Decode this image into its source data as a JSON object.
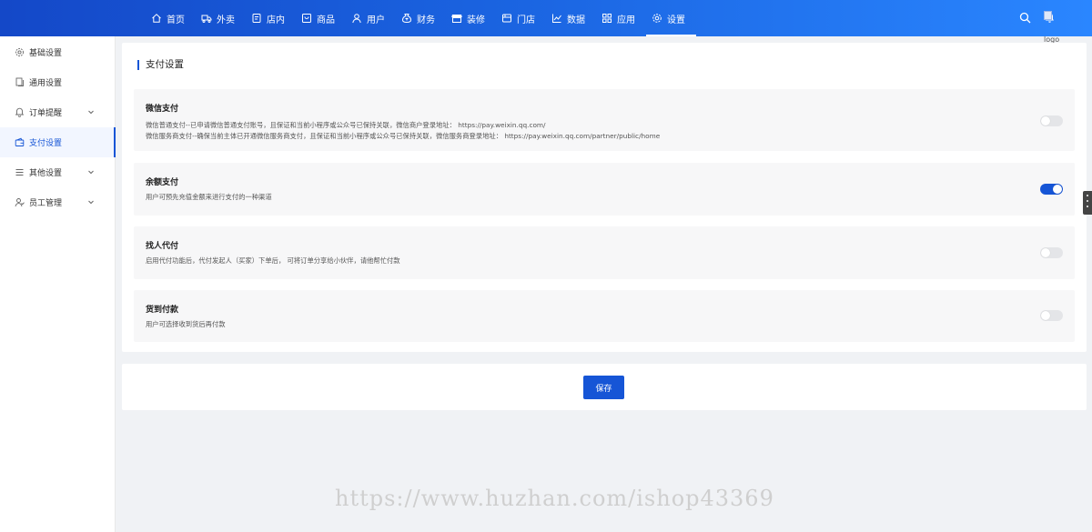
{
  "nav": {
    "items": [
      {
        "label": "首页",
        "icon": "home-icon"
      },
      {
        "label": "外卖",
        "icon": "delivery-icon"
      },
      {
        "label": "店内",
        "icon": "dine-in-icon"
      },
      {
        "label": "商品",
        "icon": "product-icon"
      },
      {
        "label": "用户",
        "icon": "user-icon"
      },
      {
        "label": "财务",
        "icon": "finance-icon"
      },
      {
        "label": "装修",
        "icon": "store-decor-icon"
      },
      {
        "label": "门店",
        "icon": "store-icon"
      },
      {
        "label": "数据",
        "icon": "chart-icon"
      },
      {
        "label": "应用",
        "icon": "apps-icon"
      },
      {
        "label": "设置",
        "icon": "gear-icon"
      }
    ],
    "active": "设置",
    "logo_alt": "logo"
  },
  "sidebar": {
    "items": [
      {
        "label": "基础设置",
        "icon": "settings-icon"
      },
      {
        "label": "通用设置",
        "icon": "document-icon"
      },
      {
        "label": "订单提醒",
        "icon": "bell-icon"
      },
      {
        "label": "支付设置",
        "icon": "wallet-icon"
      },
      {
        "label": "其他设置",
        "icon": "list-icon"
      },
      {
        "label": "员工管理",
        "icon": "staff-icon"
      }
    ],
    "active": "支付设置"
  },
  "payment": {
    "title": "支付设置",
    "options": [
      {
        "title": "微信支付",
        "desc1": "微信普通支付--已申请微信普通支付账号，且保证和当前小程序或公众号已保持关联，微信商户登录地址： https://pay.weixin.qq.com/",
        "desc2": "微信服务商支付--确保当前主体已开通微信服务商支付，且保证和当前小程序或公众号已保持关联，微信服务商登录地址： https://pay.weixin.qq.com/partner/public/home",
        "enabled": false
      },
      {
        "title": "余额支付",
        "desc1": "用户可预先充值金额来进行支付的一种渠道",
        "enabled": true
      },
      {
        "title": "找人代付",
        "desc1": "启用代付功能后，代付发起人（买家）下单后， 可将订单分享给小伙伴，请他帮忙付款",
        "enabled": false
      },
      {
        "title": "货到付款",
        "desc1": "用户可选择收到货后再付款",
        "enabled": false
      }
    ]
  },
  "save_label": "保存",
  "watermark": "https://www.huzhan.com/ishop43369",
  "colors": {
    "primary": "#1655d6",
    "topbar_start": "#1448c8",
    "topbar_end": "#2a86ff"
  }
}
